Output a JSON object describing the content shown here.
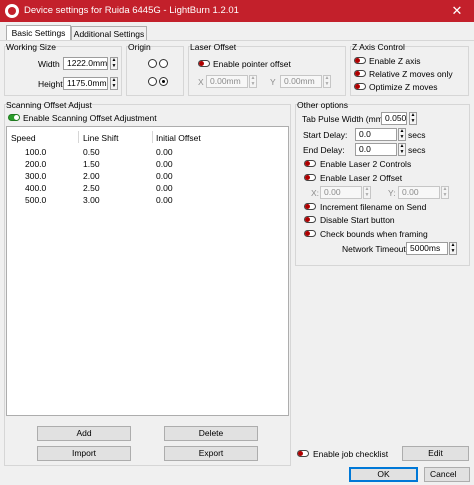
{
  "window": {
    "title": "Device settings for Ruida 6445G - LightBurn 1.2.01",
    "close_icon": "close-icon"
  },
  "tabs": [
    {
      "label": "Basic Settings",
      "active": true
    },
    {
      "label": "Additional Settings",
      "active": false
    }
  ],
  "working_size": {
    "title": "Working Size",
    "width_label": "Width",
    "width_value": "1222.0mm",
    "height_label": "Height",
    "height_value": "1175.0mm"
  },
  "origin": {
    "title": "Origin",
    "selected": "bottom-right"
  },
  "laser_offset": {
    "title": "Laser Offset",
    "enable_label": "Enable pointer offset",
    "enabled": false,
    "x_label": "X",
    "x_value": "0.00mm",
    "y_label": "Y",
    "y_value": "0.00mm"
  },
  "z_axis": {
    "title": "Z Axis Control",
    "enable_label": "Enable Z axis",
    "relative_label": "Relative Z moves only",
    "optimize_label": "Optimize Z moves",
    "enabled": false,
    "relative": false,
    "optimize": false
  },
  "scanning": {
    "title": "Scanning Offset Adjust",
    "enable_label": "Enable Scanning Offset Adjustment",
    "enabled": true,
    "columns": [
      "Speed",
      "Line Shift",
      "Initial Offset"
    ],
    "rows": [
      [
        "100.0",
        "0.50",
        "0.00"
      ],
      [
        "200.0",
        "1.50",
        "0.00"
      ],
      [
        "300.0",
        "2.00",
        "0.00"
      ],
      [
        "400.0",
        "2.50",
        "0.00"
      ],
      [
        "500.0",
        "3.00",
        "0.00"
      ]
    ],
    "add_label": "Add",
    "delete_label": "Delete",
    "import_label": "Import",
    "export_label": "Export"
  },
  "other": {
    "title": "Other options",
    "tab_pulse_label": "Tab Pulse Width (mm)",
    "tab_pulse_value": "0.050",
    "start_delay_label": "Start Delay:",
    "start_delay_value": "0.0",
    "end_delay_label": "End Delay:",
    "end_delay_value": "0.0",
    "secs": "secs",
    "laser2_controls_label": "Enable Laser 2 Controls",
    "laser2_offset_label": "Enable Laser 2 Offset",
    "x_label": "X:",
    "x_value": "0.00",
    "y_label": "Y:",
    "y_value": "0.00",
    "increment_label": "Increment filename on Send",
    "disable_start_label": "Disable Start button",
    "check_bounds_label": "Check bounds when framing",
    "network_timeout_label": "Network Timeout",
    "network_timeout_value": "5000ms"
  },
  "footer": {
    "job_checklist_label": "Enable job checklist",
    "edit_label": "Edit",
    "ok_label": "OK",
    "cancel_label": "Cancel"
  }
}
